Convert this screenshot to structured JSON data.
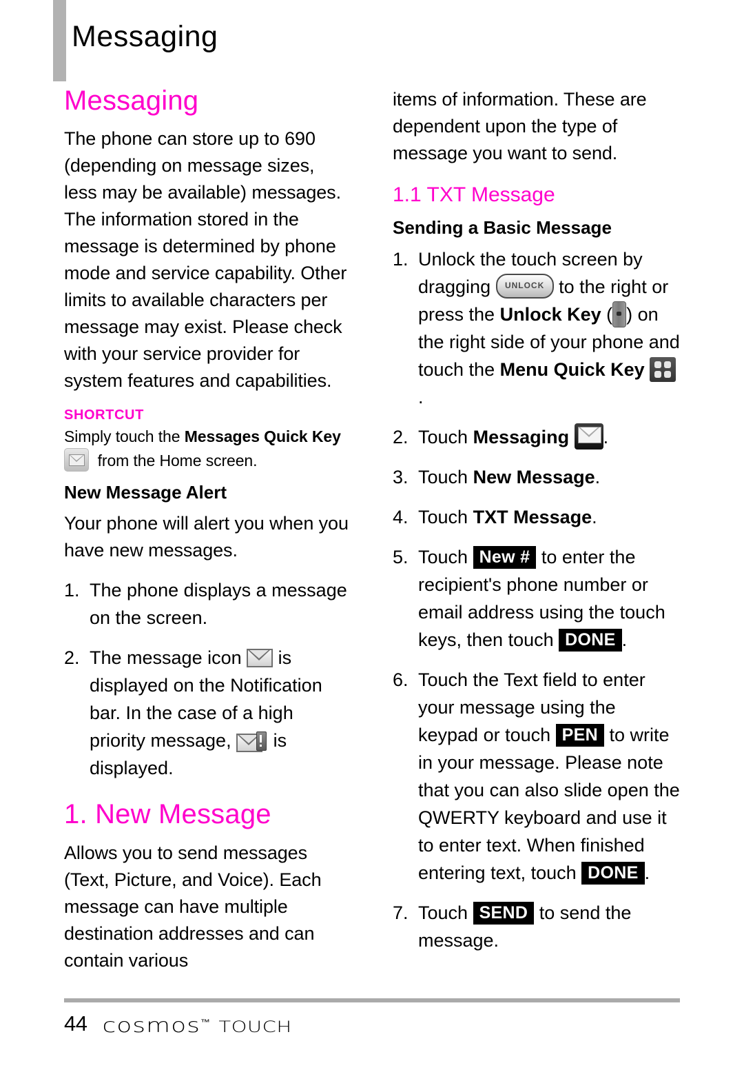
{
  "header": {
    "title": "Messaging"
  },
  "left_column": {
    "heading": "Messaging",
    "intro": "The phone can store up to 690 (depending on message sizes, less may be available) messages. The information stored in the message is determined by phone mode and service capability. Other limits to available characters per message may exist. Please check with your service provider for system features and capabilities.",
    "shortcut": {
      "label": "SHORTCUT",
      "text_before": "Simply touch the ",
      "bold_part": "Messages Quick Key",
      "icon": "messages-quick-key-icon",
      "text_after": "from the Home screen."
    },
    "alert_heading": "New Message Alert",
    "alert_intro": "Your phone will alert you when you have new messages.",
    "alert_steps": [
      {
        "num": "1.",
        "text": "The phone displays a message on the screen."
      },
      {
        "num": "2.",
        "part1": "The message icon",
        "icon1": "envelope-icon",
        "part2": "is displayed on the Notification bar. In the case of a high priority message,",
        "icon2": "envelope-priority-icon",
        "part3": "is displayed."
      }
    ],
    "new_message_heading": "1. New Message",
    "new_message_body": "Allows you to send messages (Text, Picture, and Voice). Each message can have multiple destination addresses and can contain various"
  },
  "right_column": {
    "continued_paragraph": "items of information. These are dependent upon the type of message you want to send.",
    "txt_heading": "1.1 TXT Message",
    "sending_heading": "Sending a Basic Message",
    "steps": [
      {
        "num": "1.",
        "p1": "Unlock the touch screen by dragging",
        "icon1": "unlock-slider-icon",
        "icon1_label": "UNLOCK",
        "p2": "to the right or press the",
        "bold1": "Unlock Key",
        "p3": "(",
        "icon2": "unlock-hardware-key-icon",
        "p4": ") on the right side of your phone and touch the",
        "bold2": "Menu Quick Key",
        "icon3": "menu-quick-key-icon",
        "p5": "."
      },
      {
        "num": "2.",
        "p1": "Touch",
        "bold1": "Messaging",
        "icon1": "messaging-app-icon",
        "p2": "."
      },
      {
        "num": "3.",
        "p1": "Touch",
        "bold1": "New Message",
        "p2": "."
      },
      {
        "num": "4.",
        "p1": "Touch",
        "bold1": "TXT Message",
        "p2": "."
      },
      {
        "num": "5.",
        "p1": "Touch",
        "key1": "New #",
        "p2": "to enter the recipient's phone number or email address using the touch keys, then touch",
        "key2": "DONE",
        "p3": "."
      },
      {
        "num": "6.",
        "p1": "Touch the Text field to enter your message using the keypad or touch",
        "key1": "PEN",
        "p2": "to write in your message. Please note that you can also slide open the QWERTY keyboard and use it to enter text. When finished entering text, touch",
        "key2": "DONE",
        "p3": "."
      },
      {
        "num": "7.",
        "p1": "Touch",
        "key1": "SEND",
        "p2": "to send the message."
      }
    ]
  },
  "footer": {
    "page_number": "44",
    "brand": "cosmos",
    "trademark": "™",
    "product": "TOUCH"
  },
  "colors": {
    "accent_pink": "#ff00cc",
    "header_tab_gray": "#b2b2b2",
    "footer_rule_gray": "#aaaaaa"
  }
}
